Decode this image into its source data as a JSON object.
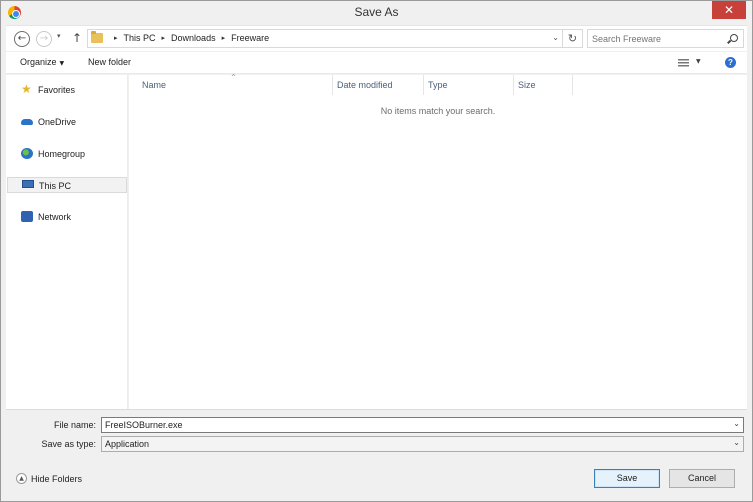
{
  "window": {
    "title": "Save As",
    "close_glyph": "✕"
  },
  "navigation": {
    "back_glyph": "←",
    "forward_glyph": "→",
    "recent_glyph": "▾",
    "up_glyph": "↑"
  },
  "address": {
    "crumbs": [
      "This PC",
      "Downloads",
      "Freeware"
    ],
    "separator_glyph": "▸",
    "dropdown_glyph": "⌄",
    "refresh_glyph": "↻"
  },
  "search": {
    "placeholder": "Search Freeware"
  },
  "toolbar": {
    "organize_label": "Organize",
    "organize_caret": "▼",
    "new_folder_label": "New folder",
    "view_caret": "▼",
    "help_glyph": "?"
  },
  "sidebar": {
    "items": [
      {
        "label": "Favorites",
        "icon": "star-icon"
      },
      {
        "label": "OneDrive",
        "icon": "cloud-icon"
      },
      {
        "label": "Homegroup",
        "icon": "homegroup-icon"
      },
      {
        "label": "This PC",
        "icon": "computer-icon",
        "selected": true
      },
      {
        "label": "Network",
        "icon": "network-icon"
      }
    ]
  },
  "file_list": {
    "columns": [
      "Name",
      "Date modified",
      "Type",
      "Size"
    ],
    "sort_glyph": "^",
    "empty_message": "No items match your search."
  },
  "form": {
    "file_name_label": "File name:",
    "file_name_value": "FreeISOBurner.exe",
    "save_as_type_label": "Save as type:",
    "save_as_type_value": "Application",
    "combo_caret": "⌄"
  },
  "footer": {
    "hide_folders_label": "Hide Folders",
    "hide_folders_glyph": "▲",
    "save_label": "Save",
    "cancel_label": "Cancel"
  }
}
